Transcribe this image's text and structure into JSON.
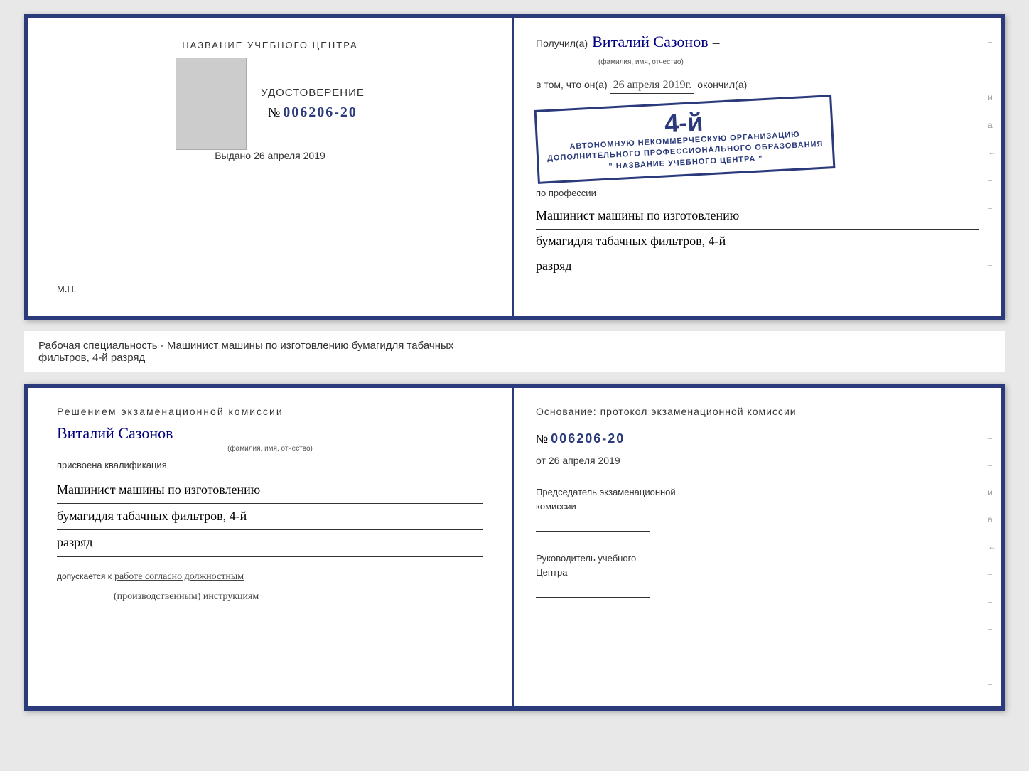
{
  "top_cert": {
    "left": {
      "training_center_label": "НАЗВАНИЕ УЧЕБНОГО ЦЕНТРА",
      "udostoverenie_label": "УДОСТОВЕРЕНИЕ",
      "cert_number_prefix": "№",
      "cert_number": "006206-20",
      "vydano_label": "Выдано",
      "vydano_date": "26 апреля 2019",
      "mp_label": "М.П."
    },
    "right": {
      "poluchil_prefix": "Получил(а)",
      "name_handwritten": "Виталий Сазонов",
      "name_hint": "(фамилия, имя, отчество)",
      "dash1": "–",
      "vtom_prefix": "в том, что он(а)",
      "date_handwritten": "26 апреля 2019г.",
      "okonchil_suffix": "окончил(а)",
      "stamp_num": "4-й",
      "stamp_line1": "АВТОНОМНУЮ НЕКОММЕРЧЕСКУЮ ОРГАНИЗАЦИЮ",
      "stamp_line2": "ДОПОЛНИТЕЛЬНОГО ПРОФЕССИОНАЛЬНОГО ОБРАЗОВАНИЯ",
      "stamp_line3": "\" НАЗВАНИЕ УЧЕБНОГО ЦЕНТРА \"",
      "dash2": "–",
      "i_text": "и",
      "a_text": "а",
      "arrow_text": "←",
      "po_professii_label": "по профессии",
      "profession_line1": "Машинист машины по изготовлению",
      "profession_line2": "бумагидля табачных фильтров, 4-й",
      "profession_line3": "разряд"
    }
  },
  "middle": {
    "text_part1": "Рабочая специальность - Машинист машины по изготовлению бумагидля табачных",
    "text_part2": "фильтров, 4-й разряд"
  },
  "bottom_cert": {
    "left": {
      "resheniem_label": "Решением  экзаменационной  комиссии",
      "name_handwritten": "Виталий Сазонов",
      "name_hint": "(фамилия, имя, отчество)",
      "prisvoena_label": "присвоена квалификация",
      "qual_line1": "Машинист машины по изготовлению",
      "qual_line2": "бумагидля табачных фильтров, 4-й",
      "qual_line3": "разряд",
      "dopuskaetsya_prefix": "допускается к",
      "dopuskaetsya_text": "работе согласно должностным",
      "dopuskaetsya_text2": "(производственным) инструкциям"
    },
    "right": {
      "osnovanie_label": "Основание:  протокол  экзаменационной  комиссии",
      "number_prefix": "№",
      "protocol_number": "006206-20",
      "ot_prefix": "от",
      "ot_date": "26 апреля 2019",
      "predsedatel_label": "Председатель экзаменационной\nкомиссии",
      "rukovoditel_label": "Руководитель учебного\nЦентра",
      "i_text": "и",
      "a_text": "а",
      "arrow_text": "←",
      "dash_items": [
        "–",
        "–",
        "–",
        "–",
        "–",
        "–",
        "–"
      ]
    }
  }
}
